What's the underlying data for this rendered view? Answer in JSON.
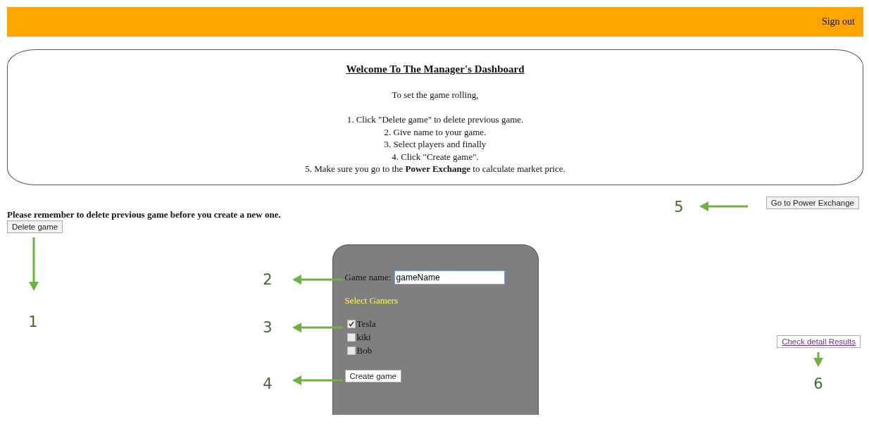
{
  "header": {
    "sign_out": "Sign out"
  },
  "welcome": {
    "title": "Welcome To The Manager's Dashboard",
    "intro": "To set the game rolling,",
    "steps": [
      "1. Click \"Delete game\" to delete previous game.",
      "2. Give name to your game.",
      "3. Select players and finally",
      "4. Click \"Create game\".",
      "5. Make sure you go to the **Power Exchange** to calculate market price."
    ]
  },
  "reminder": "Please remember to delete previous game before you create a new one.",
  "delete_button": "Delete game",
  "exchange_button": "Go to Power Exchange",
  "game_form": {
    "name_label": "Game name:",
    "name_value": "gameName",
    "gamers_title": "Select Gamers",
    "gamers": [
      {
        "name": "Tesla",
        "checked": true
      },
      {
        "name": "kiki",
        "checked": false
      },
      {
        "name": "Bob",
        "checked": false
      }
    ],
    "create_button": "Create game"
  },
  "results_link": "Check detail Results",
  "annotations": [
    {
      "label": "1"
    },
    {
      "label": "2"
    },
    {
      "label": "3"
    },
    {
      "label": "4"
    },
    {
      "label": "5"
    },
    {
      "label": "6"
    }
  ]
}
